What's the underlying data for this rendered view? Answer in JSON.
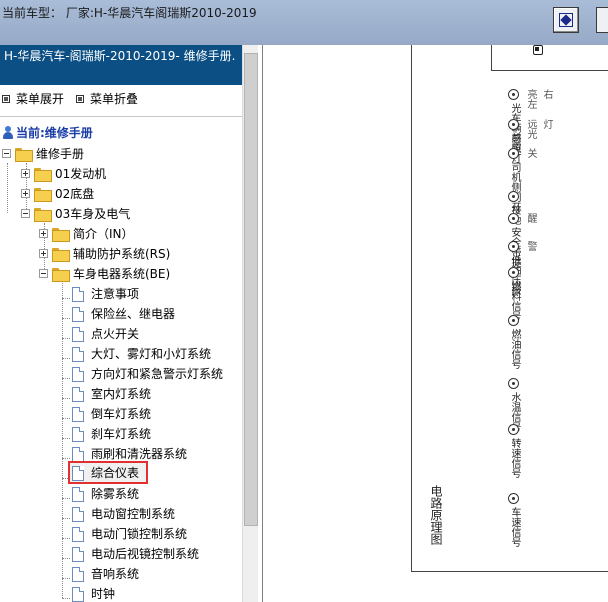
{
  "header": {
    "vehicle_info": "当前车型： 厂家:H-华晨汽车阁瑞斯2010-2019"
  },
  "sidebar": {
    "manual_title": "H-华晨汽车-阁瑞斯-2010-2019- 维修手册.",
    "expand_all": "菜单展开",
    "collapse_all": "菜单折叠",
    "current_label": "当前:维修手册",
    "tree": {
      "root": "维修手册",
      "engine": "01发动机",
      "chassis": "02底盘",
      "body_electrical": "03车身及电气",
      "intro": "简介（IN）",
      "restraint": "辅助防护系统(RS)",
      "body_electrics": "车身电器系统(BE)",
      "leaves": [
        "注意事项",
        "保险丝、继电器",
        "点火开关",
        "大灯、雾灯和小灯系统",
        "方向灯和紧急警示灯系统",
        "室内灯系统",
        "倒车灯系统",
        "刹车灯系统",
        "雨刷和清洗器系统",
        "综合仪表",
        "除雾系统",
        "电动窗控制系统",
        "电动门锁控制系统",
        "电动后视镜控制系统",
        "音响系统",
        "时钟"
      ],
      "selected": "综合仪表"
    }
  },
  "diagram": {
    "title": "电路原理图",
    "pins": [
      {
        "text": "光车辆感应",
        "sub": "亮左",
        "sub2": "右"
      },
      {
        "text": "前照灯",
        "sub": "远光",
        "sub2": "灯"
      },
      {
        "text": "司机侧门开",
        "sub": "关",
        "sub2": ""
      },
      {
        "text": "接地",
        "sub": "",
        "sub2": ""
      },
      {
        "text": "安全带提",
        "sub": "醒",
        "sub2": ""
      },
      {
        "text": "低油压报",
        "sub": "警",
        "sub2": ""
      },
      {
        "text": "燃料信号",
        "sub": "",
        "sub2": ""
      },
      {
        "text": "燃油信号",
        "sub": "",
        "sub2": ""
      },
      {
        "text": "水温信号",
        "sub": "",
        "sub2": ""
      },
      {
        "text": "转速信号",
        "sub": "",
        "sub2": ""
      },
      {
        "text": "车速信号",
        "sub": "",
        "sub2": ""
      }
    ]
  },
  "colors": {
    "title_bar": "#0b4f84",
    "highlight_border": "#e03030",
    "current_text": "#1a3da8"
  }
}
